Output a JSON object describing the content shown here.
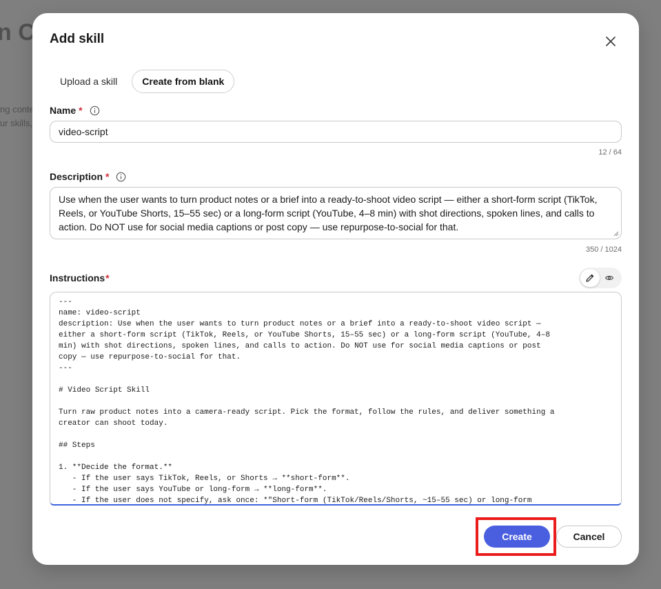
{
  "background": {
    "title_fragment": "n Co",
    "text_line1": "ng conte",
    "text_line2": "ur skills,"
  },
  "modal": {
    "title": "Add skill",
    "tabs": [
      {
        "label": "Upload a skill",
        "active": false
      },
      {
        "label": "Create from blank",
        "active": true
      }
    ],
    "name": {
      "label": "Name",
      "required_mark": "*",
      "value": "video-script",
      "counter": "12 / 64"
    },
    "description": {
      "label": "Description",
      "required_mark": "*",
      "value": "Use when the user wants to turn product notes or a brief into a ready-to-shoot video script — either a short-form script (TikTok, Reels, or YouTube Shorts, 15–55 sec) or a long-form script (YouTube, 4–8 min) with shot directions, spoken lines, and calls to action. Do NOT use for social media captions or post copy — use repurpose-to-social for that.",
      "counter": "350 / 1024"
    },
    "instructions": {
      "label": "Instructions",
      "required_mark": "*",
      "content": "---\nname: video-script\ndescription: Use when the user wants to turn product notes or a brief into a ready-to-shoot video script —\neither a short-form script (TikTok, Reels, or YouTube Shorts, 15–55 sec) or a long-form script (YouTube, 4–8\nmin) with shot directions, spoken lines, and calls to action. Do NOT use for social media captions or post\ncopy — use repurpose-to-social for that.\n---\n\n# Video Script Skill\n\nTurn raw product notes into a camera-ready script. Pick the format, follow the rules, and deliver something a\ncreator can shoot today.\n\n## Steps\n\n1. **Decide the format.**\n   - If the user says TikTok, Reels, or Shorts → **short-form**.\n   - If the user says YouTube or long-form → **long-form**.\n   - If the user does not specify, ask once: *\"Short-form (TikTok/Reels/Shorts, ~15–55 sec) or long-form"
    },
    "buttons": {
      "create": "Create",
      "cancel": "Cancel"
    },
    "colors": {
      "primary": "#4a5fe0",
      "required": "#d12b3a",
      "highlight": "#ea1c1c"
    }
  }
}
